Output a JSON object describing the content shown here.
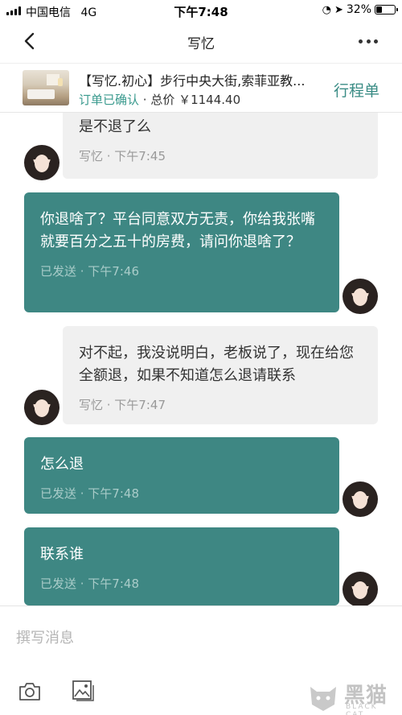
{
  "status_bar": {
    "carrier": "中国电信",
    "network": "4G",
    "time": "下午7:48",
    "battery": "32%",
    "battery_level": 0.32
  },
  "nav": {
    "title": "写忆"
  },
  "order": {
    "title": "【写忆.初心】步行中央大街,索菲亚教...",
    "status": "订单已确认",
    "price_text": " · 总价 ￥1144.40",
    "itinerary_label": "行程单"
  },
  "messages": [
    {
      "direction": "in",
      "text": "是不退了么",
      "meta": "写忆 · 下午7:45"
    },
    {
      "direction": "out",
      "text": "你退啥了？平台同意双方无责，你给我张嘴就要百分之五十的房费，请问你退啥了？",
      "meta": "已发送 · 下午7:46"
    },
    {
      "direction": "in",
      "text": "对不起，我没说明白，老板说了，现在给您全额退，如果不知道怎么退请联系",
      "meta": "写忆 · 下午7:47"
    },
    {
      "direction": "out",
      "text": "怎么退",
      "meta": "已发送 · 下午7:48"
    },
    {
      "direction": "out",
      "text": "联系谁",
      "meta": "已发送 · 下午7:48"
    }
  ],
  "composer": {
    "placeholder": "撰写消息"
  },
  "watermark": {
    "main": "黑猫",
    "sub": "BLACK CAT"
  },
  "icons": {
    "back": "back-chevron-icon",
    "more": "more-dots-icon",
    "camera": "camera-icon",
    "image": "image-icon"
  },
  "colors": {
    "outgoing_bubble": "#3e8783",
    "incoming_bubble": "#f0f0f0",
    "accent": "#3a8c85"
  }
}
